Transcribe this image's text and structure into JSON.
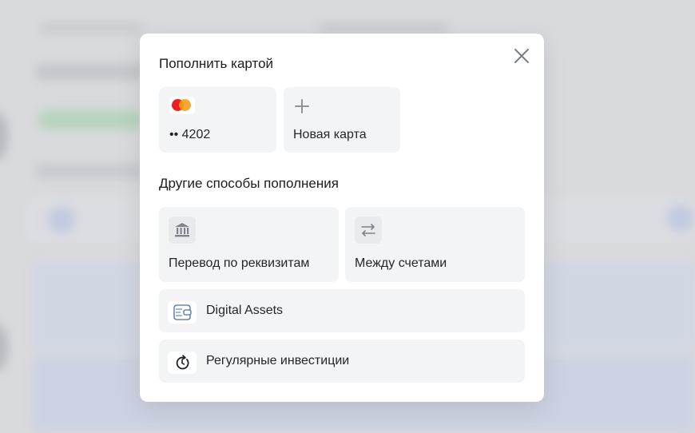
{
  "modal": {
    "title": "Пополнить картой",
    "cards": [
      {
        "label": "•• 4202",
        "icon": "mastercard-icon"
      },
      {
        "label": "Новая карта",
        "icon": "plus-icon"
      }
    ],
    "other_title": "Другие способы пополнения",
    "methods": [
      {
        "label": "Перевод по реквизитам",
        "icon": "bank-icon"
      },
      {
        "label": "Между счетами",
        "icon": "transfer-arrows-icon"
      },
      {
        "label": "Digital Assets",
        "icon": "wallet-icon"
      },
      {
        "label": "Регулярные инвестиции",
        "icon": "recurring-clock-icon"
      }
    ],
    "close_icon": "close-icon"
  },
  "colors": {
    "modal_bg": "#ffffff",
    "tile_bg": "#f3f4f6",
    "text": "#1b1c1f",
    "mastercard_red": "#eb1c26",
    "mastercard_orange": "#f79e1b"
  }
}
